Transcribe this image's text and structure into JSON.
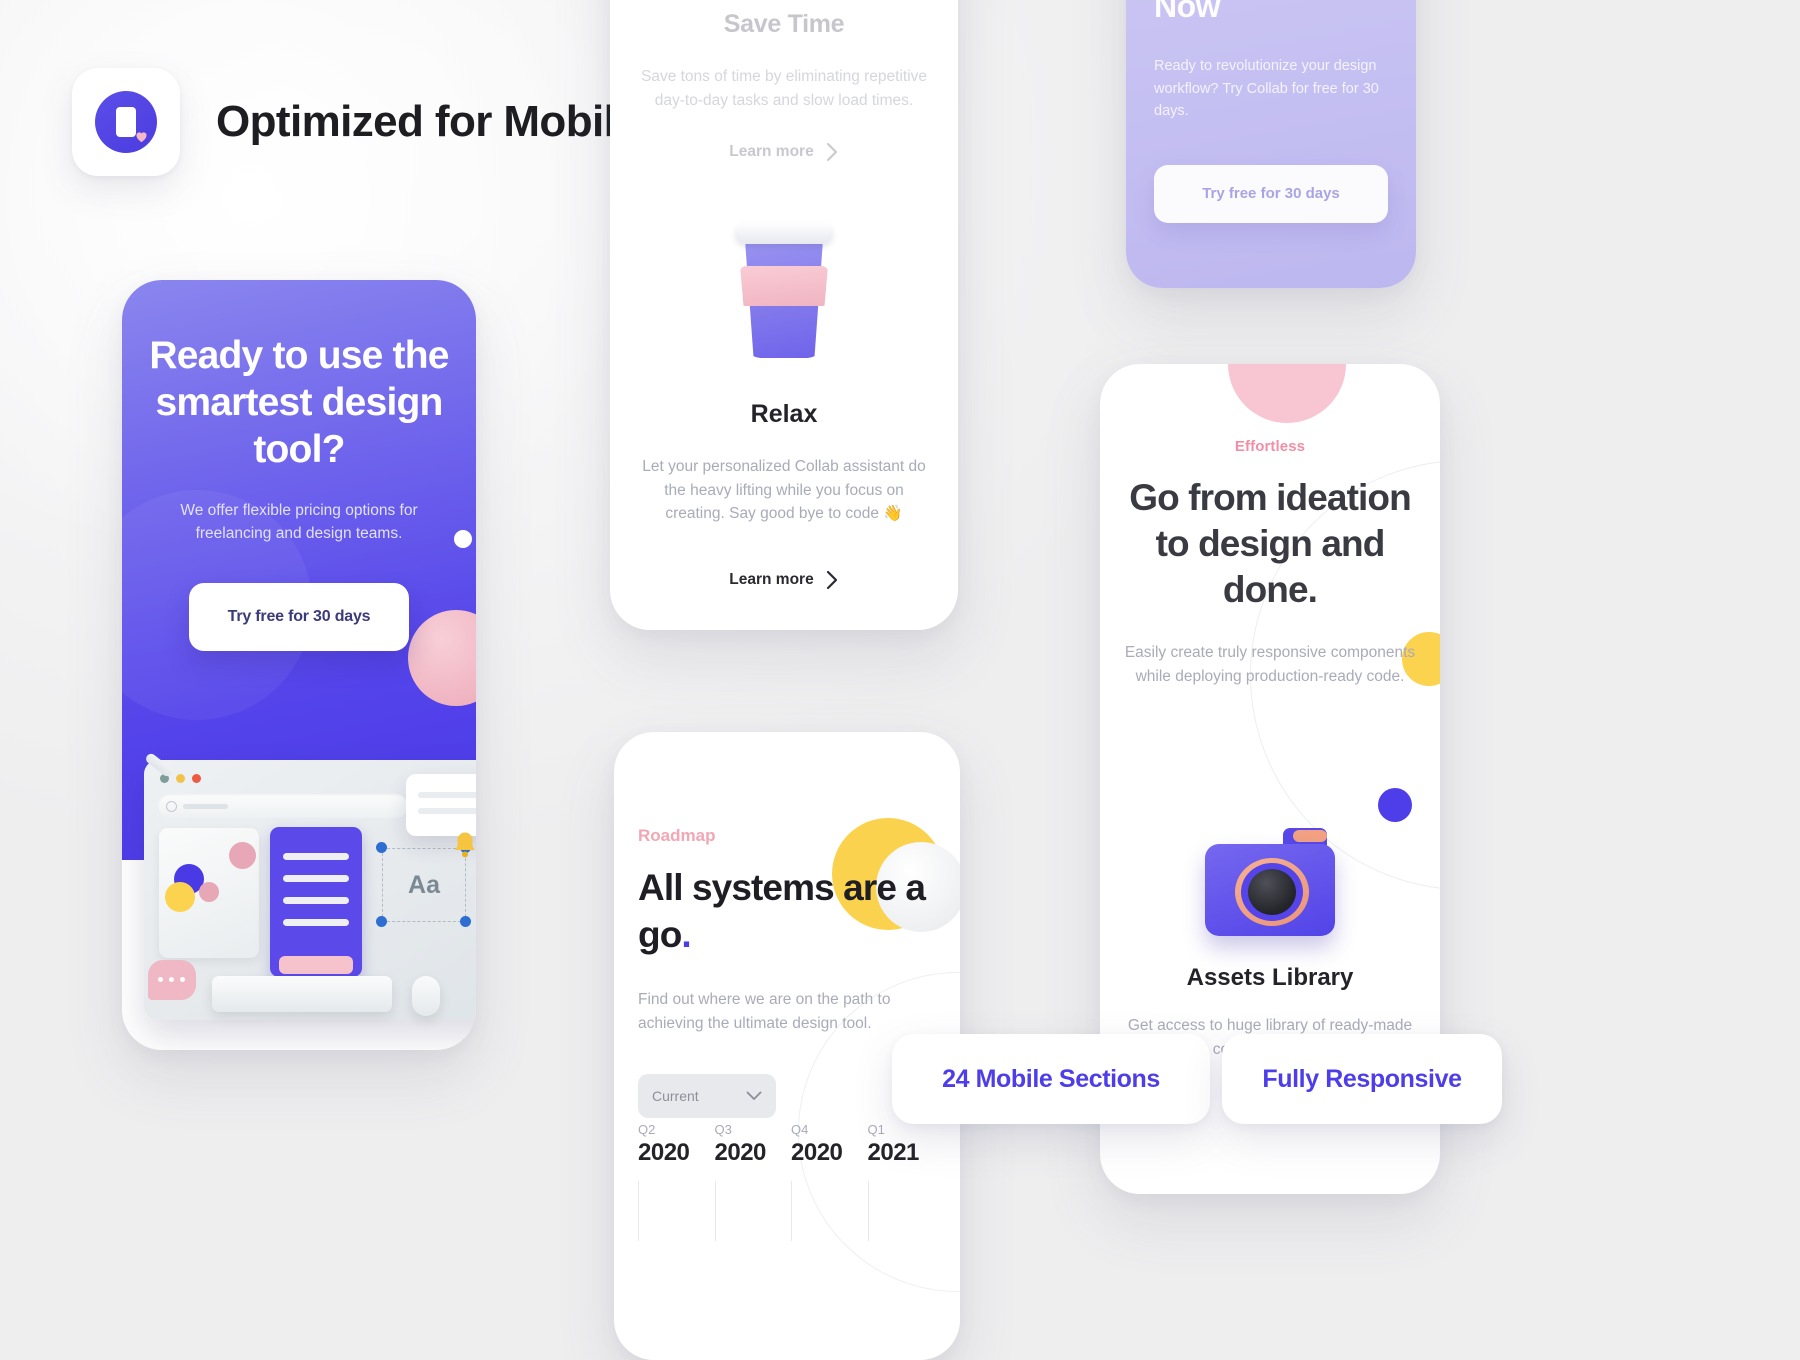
{
  "header": {
    "title": "Optimized for Mobile",
    "logo_icon": "phone-heart-icon",
    "accent_color": "#4e3ee9"
  },
  "cards": {
    "ready": {
      "heading": "Ready to use the smartest design tool?",
      "body": "We offer flexible pricing options for freelancing and design teams.",
      "cta_label": "Try free for 30 days",
      "illustration": "design-workspace-mockup",
      "mockup_text": "Aa",
      "gradient_from": "#8a86ee",
      "gradient_to": "#4b39e8"
    },
    "save_time": {
      "title": "Save Time",
      "body": "Save tons of time by eliminating repetitive day-to-day tasks and slow load times.",
      "link_label": "Learn more",
      "link_icon": "chevron-right-icon"
    },
    "relax": {
      "title": "Relax",
      "body": "Let your personalized Collab assistant do the heavy lifting while you focus on creating. Say good bye to code 👋",
      "link_label": "Learn more",
      "link_icon": "chevron-right-icon",
      "illustration": "coffee-cup"
    },
    "now": {
      "heading": "Now",
      "body": "Ready to revolutionize your design workflow? Try Collab for free for 30 days.",
      "cta_label": "Try free for 30 days"
    },
    "effortless": {
      "label": "Effortless",
      "label_color": "#f08fa6",
      "heading": "Go from ideation to design and done.",
      "body": "Easily create truly responsive components while deploying production-ready code.",
      "assets_title": "Assets Library",
      "assets_body": "Get access to huge library of ready-made components that",
      "illustration": "camera"
    },
    "roadmap": {
      "label": "Roadmap",
      "label_color": "#f2a6b6",
      "heading": "All systems are a go",
      "heading_accent": ".",
      "body": "Find out where we are on the path to achieving the ultimate design tool.",
      "select_value": "Current",
      "select_icon": "chevron-down-icon",
      "timeline": [
        {
          "quarter": "Q2",
          "year": "2020"
        },
        {
          "quarter": "Q3",
          "year": "2020"
        },
        {
          "quarter": "Q4",
          "year": "2020"
        },
        {
          "quarter": "Q1",
          "year": "2021"
        }
      ]
    }
  },
  "badges": [
    {
      "label": "24 Mobile Sections"
    },
    {
      "label": "Fully Responsive"
    }
  ]
}
